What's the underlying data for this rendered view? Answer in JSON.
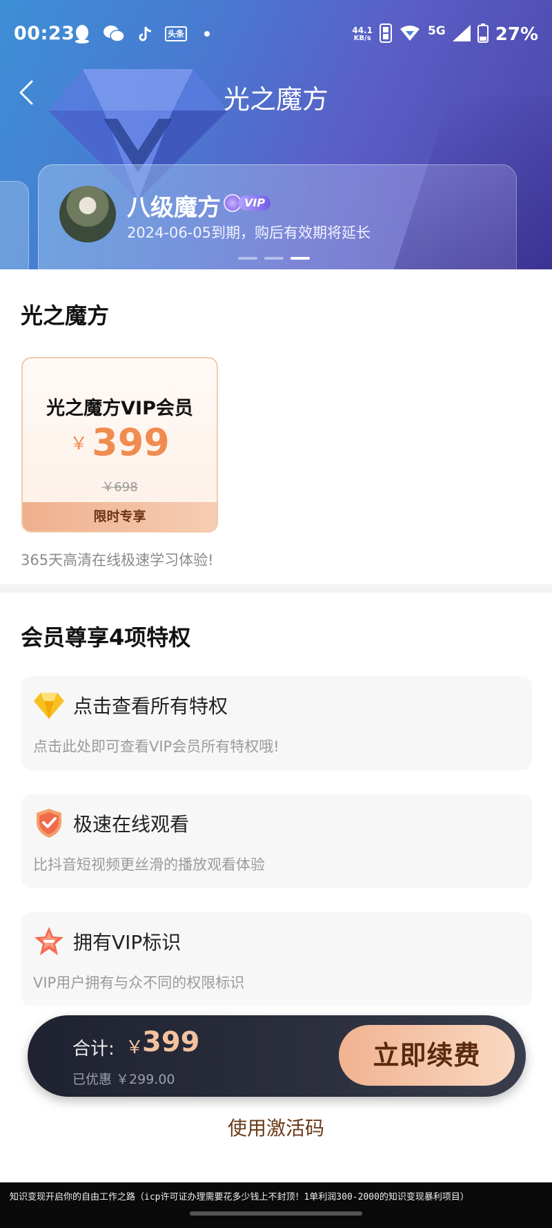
{
  "statusbar": {
    "time": "00:23",
    "net_speed_value": "44.1",
    "net_speed_unit": "KB/s",
    "network": "5G",
    "battery": "27%",
    "icons": [
      "qq-icon",
      "wechat-icon",
      "tiktok-icon",
      "toutiao-icon",
      "dot-icon",
      "hd-icon",
      "wifi-icon",
      "signal-icon",
      "battery-icon"
    ],
    "toutiao_label": "头条"
  },
  "header": {
    "title": "光之魔方",
    "member_card": {
      "level": "八级魔方",
      "vip_label": "VIP",
      "expire_text": "2024-06-05到期，购后有效期将延长"
    },
    "carousel_active_index": 2,
    "carousel_count": 3
  },
  "product_section": {
    "title": "光之魔方",
    "card": {
      "name": "光之魔方VIP会员",
      "currency": "￥",
      "price": "399",
      "original_price": "￥698",
      "tag": "限时专享"
    },
    "description": "365天高清在线极速学习体验!"
  },
  "privileges": {
    "title": "会员尊享4项特权",
    "items": [
      {
        "icon": "diamond-icon",
        "title": "点击查看所有特权",
        "desc": "点击此处即可查看VIP会员所有特权哦!"
      },
      {
        "icon": "shield-check-icon",
        "title": "极速在线观看",
        "desc": "比抖音短视频更丝滑的播放观看体验"
      },
      {
        "icon": "star-badge-icon",
        "title": "拥有VIP标识",
        "desc": "VIP用户拥有与众不同的权限标识"
      }
    ]
  },
  "checkout": {
    "total_label": "合计:",
    "currency": "￥",
    "total": "399",
    "discount_text": "已优惠 ￥299.00",
    "renew_button": "立即续费",
    "activation_link": "使用激活码"
  },
  "caption": "知识变现开启你的自由工作之路（icp许可证办理需要花多少钱上不封顶！1单利润300-2000的知识变现暴利项目）",
  "colors": {
    "accent_price": "#f08c50",
    "button_gradient_start": "#f1b391",
    "button_gradient_end": "#f9d8c1",
    "bar_dark": "#1f2230"
  }
}
